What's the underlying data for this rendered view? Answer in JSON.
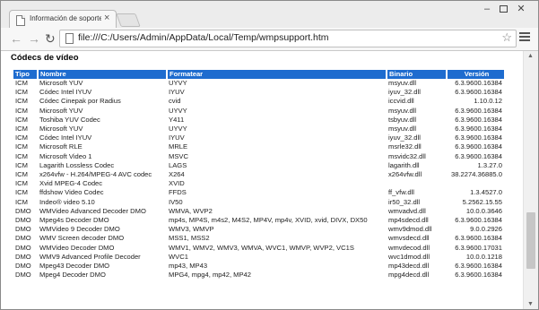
{
  "browser": {
    "tab_title": "Información de soporte té",
    "url": "file:///C:/Users/Admin/AppData/Local/Temp/wmpsupport.htm"
  },
  "page": {
    "heading": "Códecs de vídeo",
    "columns": [
      "Tipo",
      "Nombre",
      "Formatear",
      "Binario",
      "Versión"
    ],
    "rows": [
      [
        "ICM",
        "Microsoft YUV",
        "UYVY",
        "msyuv.dll",
        "6.3.9600.16384"
      ],
      [
        "ICM",
        "Códec Intel IYUV",
        "IYUV",
        "iyuv_32.dll",
        "6.3.9600.16384"
      ],
      [
        "ICM",
        "Códec Cinepak por Radius",
        "cvid",
        "iccvid.dll",
        "1.10.0.12"
      ],
      [
        "ICM",
        "Microsoft YUV",
        "UYVY",
        "msyuv.dll",
        "6.3.9600.16384"
      ],
      [
        "ICM",
        "Toshiba YUV Codec",
        "Y411",
        "tsbyuv.dll",
        "6.3.9600.16384"
      ],
      [
        "ICM",
        "Microsoft YUV",
        "UYVY",
        "msyuv.dll",
        "6.3.9600.16384"
      ],
      [
        "ICM",
        "Códec Intel IYUV",
        "IYUV",
        "iyuv_32.dll",
        "6.3.9600.16384"
      ],
      [
        "ICM",
        "Microsoft RLE",
        "MRLE",
        "msrle32.dll",
        "6.3.9600.16384"
      ],
      [
        "ICM",
        "Microsoft Video 1",
        "MSVC",
        "msvidc32.dll",
        "6.3.9600.16384"
      ],
      [
        "ICM",
        "Lagarith Lossless Codec",
        "LAGS",
        "lagarith.dll",
        "1.3.27.0"
      ],
      [
        "ICM",
        "x264vfw - H.264/MPEG-4 AVC codec",
        "X264",
        "x264vfw.dll",
        "38.2274.36885.0"
      ],
      [
        "ICM",
        "Xvid MPEG-4 Codec",
        "XVID",
        "",
        ""
      ],
      [
        "ICM",
        "ffdshow Video Codec",
        "FFDS",
        "ff_vfw.dll",
        "1.3.4527.0"
      ],
      [
        "ICM",
        "Indeo® video 5.10",
        "IV50",
        "ir50_32.dll",
        "5.2562.15.55"
      ],
      [
        "DMO",
        "WMVideo Advanced Decoder DMO",
        "WMVA, WVP2",
        "wmvadvd.dll",
        "10.0.0.3646"
      ],
      [
        "DMO",
        "Mpeg4s Decoder DMO",
        "mp4s, MP4S, m4s2, M4S2, MP4V, mp4v, XVID, xvid, DIVX, DX50",
        "mp4sdecd.dll",
        "6.3.9600.16384"
      ],
      [
        "DMO",
        "WMVideo 9 Decoder DMO",
        "WMV3, WMVP",
        "wmv9dmod.dll",
        "9.0.0.2926"
      ],
      [
        "DMO",
        "WMV Screen decoder DMO",
        "MSS1, MSS2",
        "wmvsdecd.dll",
        "6.3.9600.16384"
      ],
      [
        "DMO",
        "WMVideo Decoder DMO",
        "WMV1, WMV2, WMV3, WMVA, WVC1, WMVP, WVP2, VC1S",
        "wmvdecod.dll",
        "6.3.9600.17031"
      ],
      [
        "DMO",
        "WMV9 Advanced Profile Decoder",
        "WVC1",
        "wvc1dmod.dll",
        "10.0.0.1218"
      ],
      [
        "DMO",
        "Mpeg43 Decoder DMO",
        "mp43, MP43",
        "mp43decd.dll",
        "6.3.9600.16384"
      ],
      [
        "DMO",
        "Mpeg4 Decoder DMO",
        "MPG4, mpg4, mp42, MP42",
        "mpg4decd.dll",
        "6.3.9600.16384"
      ]
    ]
  },
  "colors": {
    "header_bg": "#1e6ccf",
    "header_text": "#ffffff"
  }
}
